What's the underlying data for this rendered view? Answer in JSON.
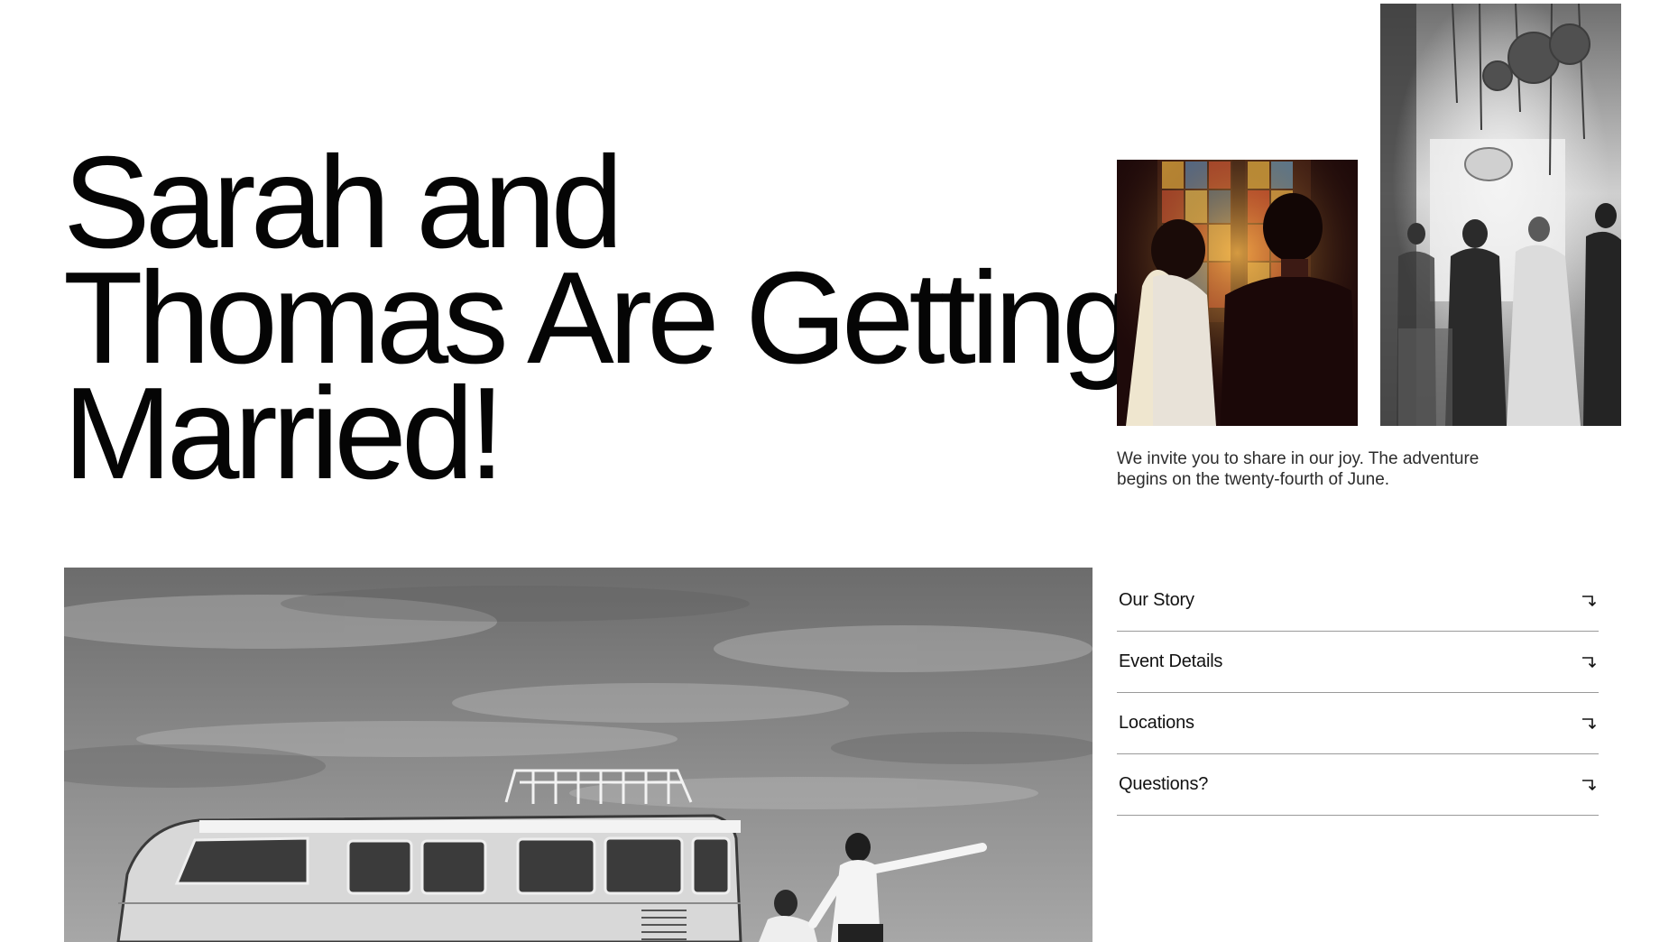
{
  "hero": {
    "title_line1": "Sarah and",
    "title_line2": "Thomas Are Getting",
    "title_line3": "Married!"
  },
  "invite": {
    "text": "We invite you to share in our joy. The adventure begins on the twenty-fourth of June."
  },
  "nav": {
    "items": [
      {
        "label": "Our Story",
        "icon": "arrow-down-right-icon"
      },
      {
        "label": "Event Details",
        "icon": "arrow-down-right-icon"
      },
      {
        "label": "Locations",
        "icon": "arrow-down-right-icon"
      },
      {
        "label": "Questions?",
        "icon": "arrow-down-right-icon"
      }
    ]
  },
  "photos": {
    "church": "couple-stained-glass-photo",
    "ceremony": "ceremony-aisle-photo",
    "van": "couple-van-photo"
  },
  "colors": {
    "text": "#050505",
    "divider": "#9a9a9a",
    "background": "#ffffff"
  }
}
